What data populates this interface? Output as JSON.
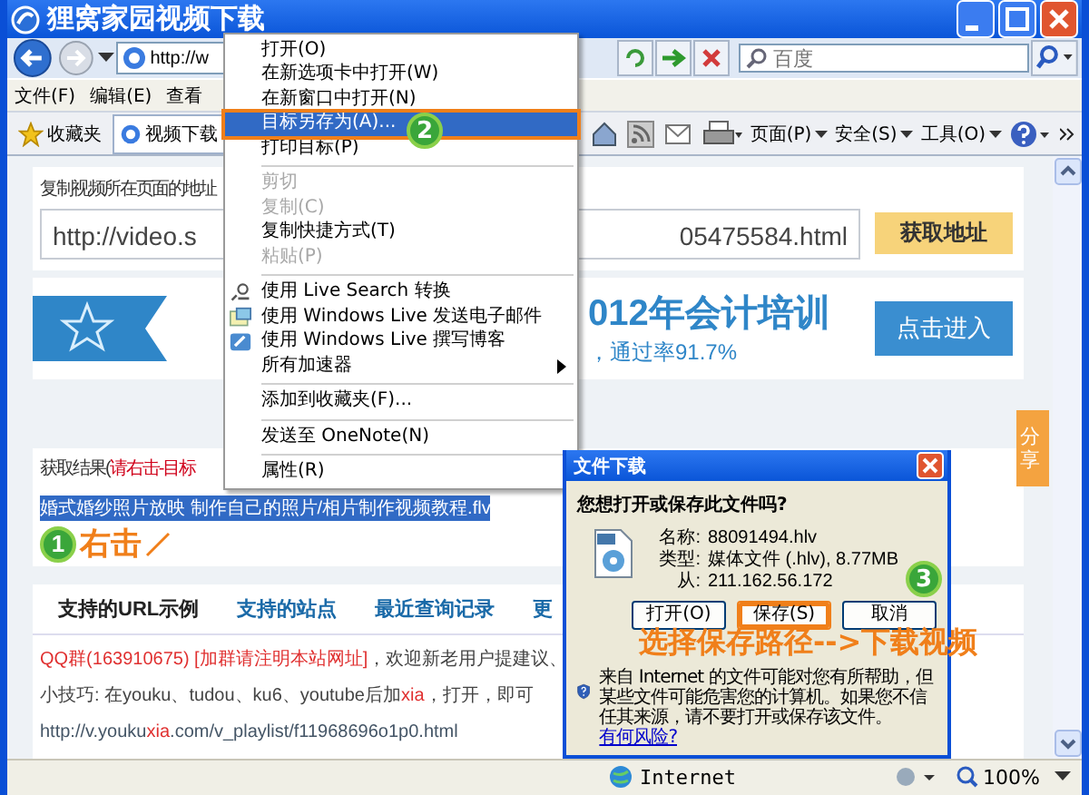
{
  "window": {
    "title": "狸窝家园视频下载"
  },
  "address_bar": {
    "value": "http://w"
  },
  "search": {
    "placeholder": "百度"
  },
  "menu_bar": [
    "文件(F)",
    "编辑(E)",
    "查看"
  ],
  "favorites": {
    "label": "收藏夹"
  },
  "tabs": [
    {
      "label": "视频下载",
      "selected": true
    }
  ],
  "command_bar": [
    "页面(P)",
    "安全(S)",
    "工具(O)"
  ],
  "page": {
    "url_label": "复制视频所在页面的地址",
    "url_field": {
      "value_start": "http://video.s",
      "value_end": "05475584.html"
    },
    "fetch_button": "获取地址",
    "banner": {
      "title": "012年会计培训",
      "subtitle": "，通过率91.7%",
      "button": "点击进入"
    },
    "result_label": "获取结果(",
    "result_hint": "请右击-目标",
    "result_link": "婚式婚纱照片放映 制作自己的照片/相片制作视频教程.flv",
    "section_tabs": [
      {
        "label": "支持的URL示例",
        "selected": true
      },
      {
        "label": "支持的站点",
        "selected": false
      },
      {
        "label": "最近查询记录",
        "selected": false
      },
      {
        "label": "更",
        "selected": false
      }
    ],
    "lines": [
      {
        "kind": "qq",
        "red": "QQ群(163910675) [加群请注明本站网址]",
        "text": "，欢迎新老用户提建议、"
      },
      {
        "kind": "tip",
        "text": "小技巧: 在youku、tudou、ku6、youtube后加",
        "red": "xia",
        "rest": "，打开，即可"
      },
      {
        "kind": "link",
        "text": "http://v.youku",
        "red": "xia",
        "rest": ".com/v_playlist/f11968696o1p0.html"
      }
    ],
    "share_tab": "分享"
  },
  "context_menu": {
    "groups": [
      [
        {
          "label": "打开(O)",
          "kind": "plain",
          "disabled": false,
          "selected": false
        },
        {
          "label": "在新选项卡中打开(W)",
          "kind": "plain",
          "disabled": false,
          "selected": false
        },
        {
          "label": "在新窗口中打开(N)",
          "kind": "plain",
          "disabled": false,
          "selected": false
        },
        {
          "label": "目标另存为(A)...",
          "kind": "plain",
          "disabled": false,
          "selected": true
        },
        {
          "label": "打印目标(P)",
          "kind": "plain",
          "disabled": false,
          "selected": false
        }
      ],
      [
        {
          "label": "剪切",
          "kind": "plain",
          "disabled": true,
          "selected": false
        },
        {
          "label": "复制(C)",
          "kind": "plain",
          "disabled": true,
          "selected": false
        },
        {
          "label": "复制快捷方式(T)",
          "kind": "plain",
          "disabled": false,
          "selected": false
        },
        {
          "label": "粘贴(P)",
          "kind": "plain",
          "disabled": true,
          "selected": false
        }
      ],
      [
        {
          "label": "使用 Live Search 转换",
          "kind": "search",
          "disabled": false,
          "selected": false
        },
        {
          "label": "使用 Windows Live 发送电子邮件",
          "kind": "mail",
          "disabled": false,
          "selected": false
        },
        {
          "label": "使用 Windows Live 撰写博客",
          "kind": "blog",
          "disabled": false,
          "selected": false
        },
        {
          "label": "所有加速器",
          "kind": "submenu",
          "disabled": false,
          "selected": false
        }
      ],
      [
        {
          "label": "添加到收藏夹(F)...",
          "kind": "plain",
          "disabled": false,
          "selected": false
        }
      ],
      [
        {
          "label": "发送至 OneNote(N)",
          "kind": "plain",
          "disabled": false,
          "selected": false
        }
      ],
      [
        {
          "label": "属性(R)",
          "kind": "plain",
          "disabled": false,
          "selected": false
        }
      ]
    ]
  },
  "dialog": {
    "title": "文件下载",
    "question": "您想打开或保存此文件吗?",
    "fields": [
      {
        "label": "名称:",
        "value": "88091494.hlv"
      },
      {
        "label": "类型:",
        "value": "媒体文件 (.hlv), 8.77MB"
      },
      {
        "label": "从:",
        "value": "211.162.56.172"
      }
    ],
    "buttons": [
      {
        "label": "打开(O)",
        "selected": false
      },
      {
        "label": "保存(S)",
        "selected": true
      },
      {
        "label": "取消",
        "selected": false
      }
    ],
    "warning": "来自 Internet 的文件可能对您有所帮助，但某些文件可能危害您的计算机。如果您不信任其来源，请不要打开或保存该文件。",
    "warning_link": "有何风险?"
  },
  "annotations": {
    "step1": {
      "number": "1",
      "text": "右击"
    },
    "step2": {
      "number": "2"
    },
    "step3": {
      "number": "3"
    },
    "caption": "选择保存路径-->下载视频"
  },
  "status_bar": {
    "zone": "Internet",
    "zoom": "100%"
  }
}
